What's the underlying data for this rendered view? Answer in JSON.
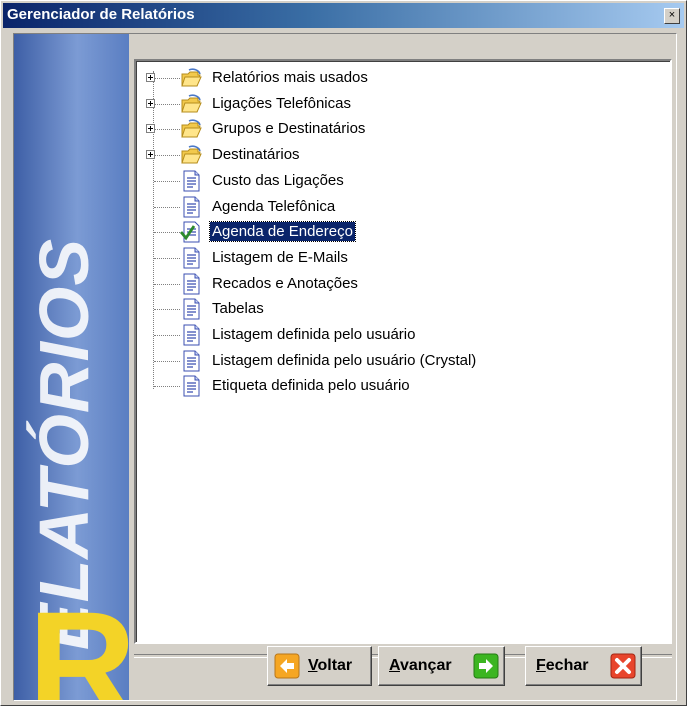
{
  "window": {
    "title": "Gerenciador de Relatórios",
    "close_glyph": "×"
  },
  "banner": {
    "word": "ELATÓRIOS",
    "initial": "R"
  },
  "tree": {
    "items": [
      {
        "label": "Relatórios mais usados",
        "type": "folder",
        "expandable": true,
        "selected": false
      },
      {
        "label": "Ligações Telefônicas",
        "type": "folder",
        "expandable": true,
        "selected": false
      },
      {
        "label": "Grupos e Destinatários",
        "type": "folder",
        "expandable": true,
        "selected": false
      },
      {
        "label": "Destinatários",
        "type": "folder",
        "expandable": true,
        "selected": false
      },
      {
        "label": "Custo das Ligações",
        "type": "document",
        "expandable": false,
        "selected": false
      },
      {
        "label": "Agenda Telefônica",
        "type": "document",
        "expandable": false,
        "selected": false
      },
      {
        "label": "Agenda de Endereço",
        "type": "document-check",
        "expandable": false,
        "selected": true
      },
      {
        "label": "Listagem de E-Mails",
        "type": "document",
        "expandable": false,
        "selected": false
      },
      {
        "label": "Recados e Anotações",
        "type": "document",
        "expandable": false,
        "selected": false
      },
      {
        "label": "Tabelas",
        "type": "document",
        "expandable": false,
        "selected": false
      },
      {
        "label": "Listagem definida pelo usuário",
        "type": "document",
        "expandable": false,
        "selected": false
      },
      {
        "label": "Listagem definida pelo usuário (Crystal)",
        "type": "document",
        "expandable": false,
        "selected": false
      },
      {
        "label": "Etiqueta definida pelo usuário",
        "type": "document",
        "expandable": false,
        "selected": false
      }
    ]
  },
  "buttons": {
    "back": {
      "accel": "V",
      "rest": "oltar",
      "icon": "arrow-left-icon",
      "color": "#f5a623"
    },
    "next": {
      "accel": "A",
      "rest": "vançar",
      "icon": "arrow-right-icon",
      "color": "#3cb521"
    },
    "close": {
      "accel": "F",
      "rest": "echar",
      "icon": "close-x-icon",
      "color": "#e8452c"
    }
  },
  "colors": {
    "selection": "#0a246a",
    "banner_accent": "#f3d327",
    "banner_blue": "#5a7ec2"
  }
}
